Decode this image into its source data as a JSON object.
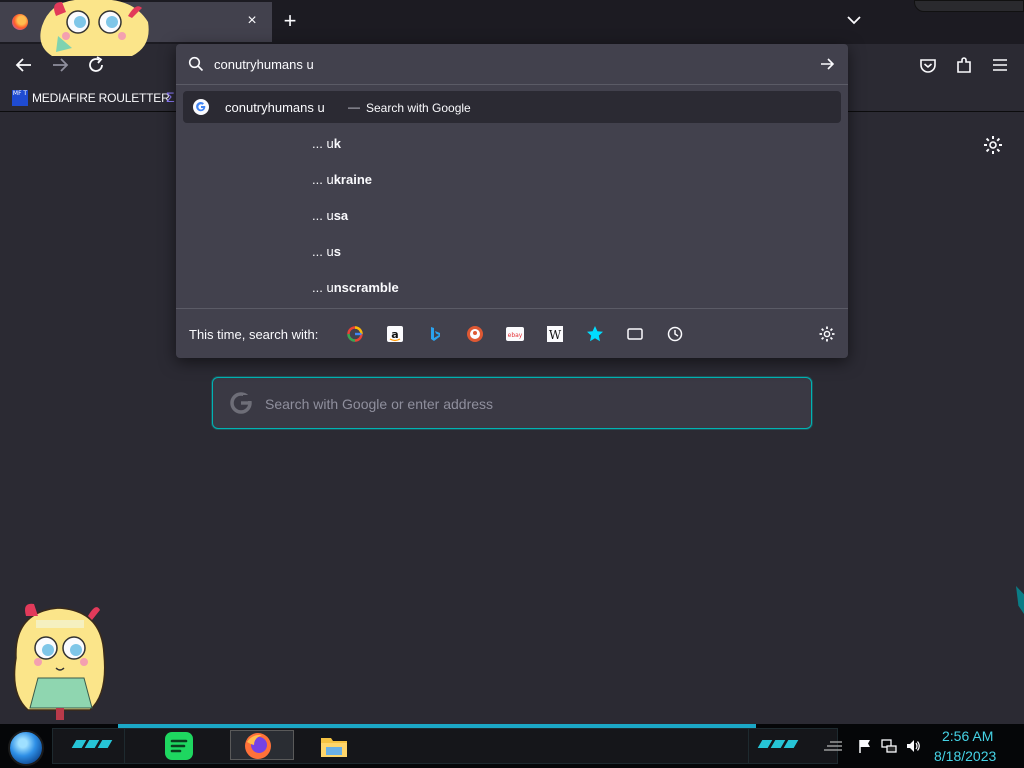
{
  "browser": {
    "new_tab_symbol": "+",
    "close_tab_symbol": "×"
  },
  "bookmarks": {
    "items": [
      {
        "icon_text": "MF T",
        "label": "MEDIAFIRE ROULETTER"
      }
    ]
  },
  "urlbar": {
    "query": "conutryhumans u",
    "main_suggestion": {
      "query": "conutryhumans u",
      "separator": "—",
      "action": "Search with Google"
    },
    "tail_suggestions": [
      {
        "prefix": "... u",
        "completion": "k"
      },
      {
        "prefix": "... u",
        "completion": "kraine"
      },
      {
        "prefix": "... u",
        "completion": "sa"
      },
      {
        "prefix": "... u",
        "completion": "s"
      },
      {
        "prefix": "... u",
        "completion": "nscramble"
      }
    ],
    "one_off_label": "This time, search with:",
    "one_off_engines": [
      "google-icon",
      "amazon-icon",
      "bing-icon",
      "duckduckgo-icon",
      "ebay-icon",
      "wikipedia-icon",
      "bookmarks-icon",
      "tabs-icon",
      "history-icon"
    ]
  },
  "newtab": {
    "search_placeholder": "Search with Google or enter address"
  },
  "taskbar": {
    "time": "2:56 AM",
    "date": "8/18/2023"
  },
  "colors": {
    "page_bg": "#2b2a33",
    "panel_bg": "#42414d",
    "accent": "#00b3b3",
    "clock": "#45d3e6"
  }
}
